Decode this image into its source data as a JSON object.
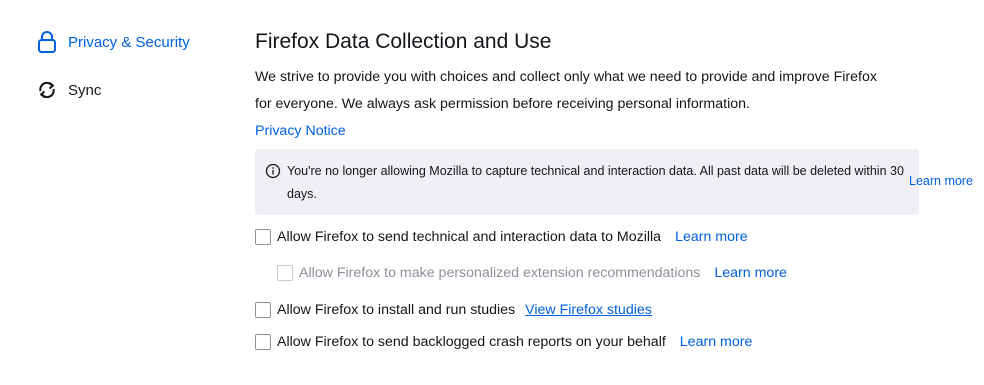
{
  "sidebar": {
    "items": [
      {
        "label": "Privacy & Security",
        "icon": "lock-icon",
        "selected": true
      },
      {
        "label": "Sync",
        "icon": "sync-icon",
        "selected": false
      }
    ]
  },
  "main": {
    "title": "Firefox Data Collection and Use",
    "description": "We strive to provide you with choices and collect only what we need to provide and improve Firefox for everyone. We always ask permission before receiving personal information.",
    "privacy_notice_link": "Privacy Notice",
    "notice": {
      "icon": "info-icon",
      "text": "You're no longer allowing Mozilla to capture technical and interaction data. All past data will be deleted within 30 days.",
      "link": "Learn more"
    },
    "options": [
      {
        "label": "Allow Firefox to send technical and interaction data to Mozilla",
        "link": "Learn more",
        "checked": false,
        "disabled": false
      },
      {
        "label": "Allow Firefox to make personalized extension recommendations",
        "link": "Learn more",
        "checked": false,
        "disabled": true
      },
      {
        "label": "Allow Firefox to install and run studies",
        "link": "View Firefox studies",
        "checked": false,
        "disabled": false
      },
      {
        "label": "Allow Firefox to send backlogged crash reports on your behalf",
        "link": "Learn more",
        "checked": false,
        "disabled": false
      }
    ]
  },
  "colors": {
    "accent": "#0061e0",
    "notice_bg": "#f0f0f4",
    "text": "#15141a",
    "disabled_text": "#8f8f9d"
  }
}
